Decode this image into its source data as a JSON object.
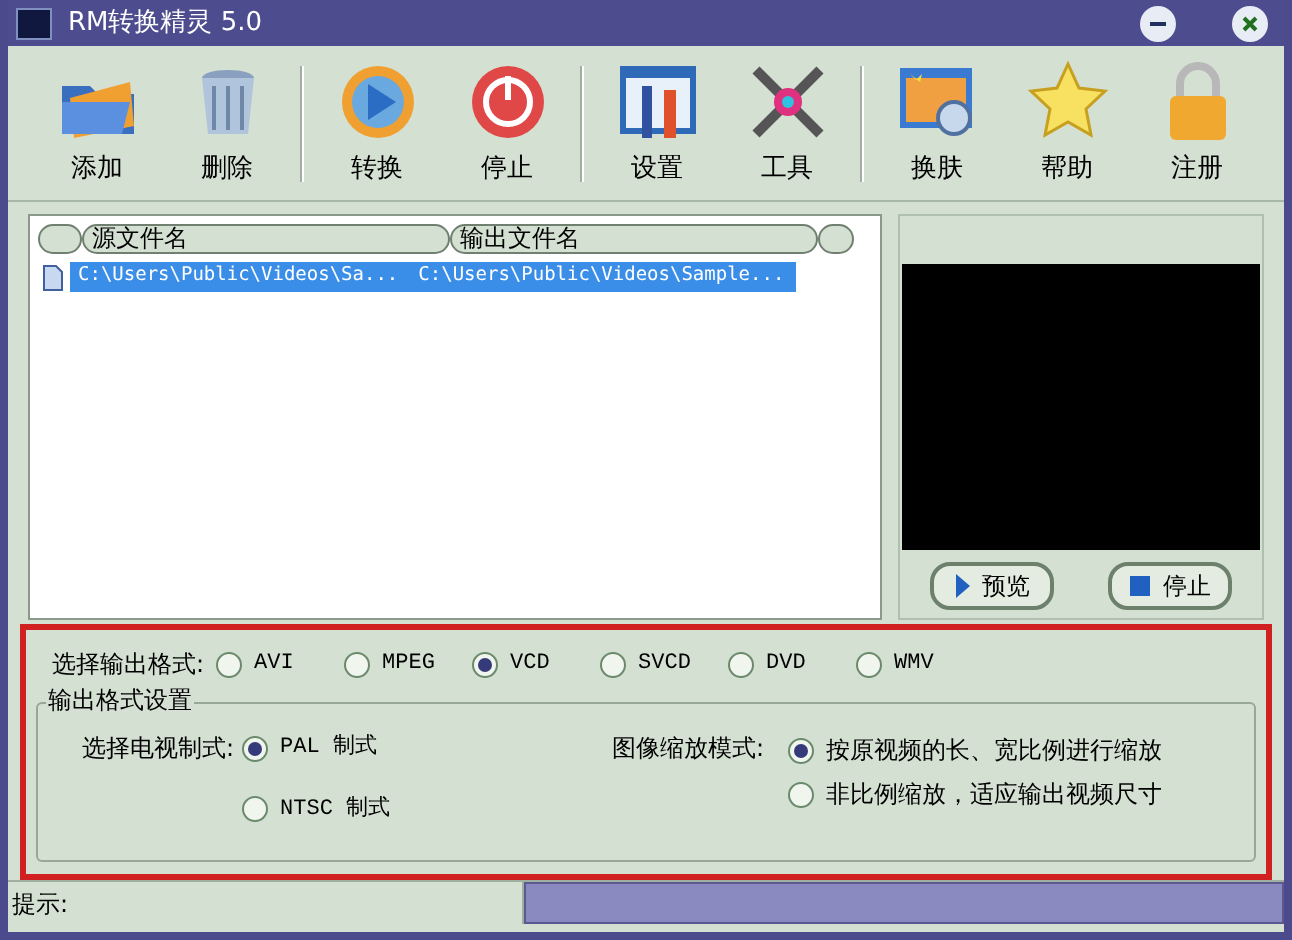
{
  "window": {
    "title": "RM转换精灵 5.0"
  },
  "toolbar": {
    "groups": [
      [
        "添加",
        "删除"
      ],
      [
        "转换",
        "停止"
      ],
      [
        "设置",
        "工具"
      ],
      [
        "换肤",
        "帮助",
        "注册"
      ]
    ]
  },
  "file_list": {
    "columns": [
      "源文件名",
      "输出文件名"
    ],
    "rows": [
      {
        "source": "C:\\Users\\Public\\Videos\\Sa...",
        "output": "C:\\Users\\Public\\Videos\\Sample...",
        "selected": true
      }
    ]
  },
  "preview": {
    "buttons": [
      "预览",
      "停止"
    ]
  },
  "output_format": {
    "label": "选择输出格式:",
    "options": [
      {
        "label": "AVI",
        "selected": false
      },
      {
        "label": "MPEG",
        "selected": false
      },
      {
        "label": "VCD",
        "selected": true
      },
      {
        "label": "SVCD",
        "selected": false
      },
      {
        "label": "DVD",
        "selected": false
      },
      {
        "label": "WMV",
        "selected": false
      }
    ]
  },
  "format_settings": {
    "title": "输出格式设置",
    "tv_system": {
      "label": "选择电视制式:",
      "options": [
        {
          "label": "PAL  制式",
          "selected": true
        },
        {
          "label": "NTSC 制式",
          "selected": false
        }
      ]
    },
    "scale_mode": {
      "label": "图像缩放模式:",
      "options": [
        {
          "label": "按原视频的长、宽比例进行缩放",
          "selected": true
        },
        {
          "label": "非比例缩放，适应输出视频尺寸",
          "selected": false
        }
      ]
    }
  },
  "status_bar": {
    "hint_label": "提示:"
  }
}
